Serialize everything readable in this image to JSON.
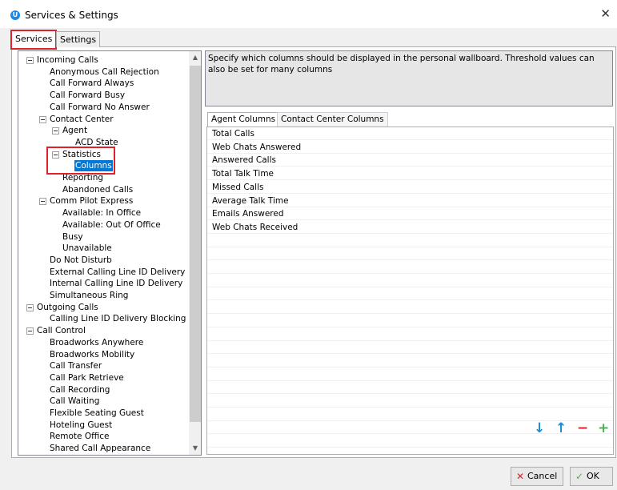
{
  "window": {
    "title": "Services & Settings",
    "app_icon_letter": "U",
    "close_glyph": "✕"
  },
  "tabs": [
    {
      "label": "Services",
      "active": true
    },
    {
      "label": "Settings",
      "active": false
    }
  ],
  "tree": {
    "items": [
      {
        "label": "Incoming Calls",
        "level": 0,
        "expandable": true
      },
      {
        "label": "Anonymous Call Rejection",
        "level": 1
      },
      {
        "label": "Call Forward Always",
        "level": 1
      },
      {
        "label": "Call Forward Busy",
        "level": 1
      },
      {
        "label": "Call Forward No Answer",
        "level": 1
      },
      {
        "label": "Contact Center",
        "level": 1,
        "expandable": true
      },
      {
        "label": "Agent",
        "level": 2,
        "expandable": true
      },
      {
        "label": "ACD State",
        "level": 3
      },
      {
        "label": "Statistics",
        "level": 2,
        "expandable": true,
        "highlighted": true
      },
      {
        "label": "Columns",
        "level": 3,
        "selected": true,
        "highlighted": true
      },
      {
        "label": "Reporting",
        "level": 2
      },
      {
        "label": "Abandoned Calls",
        "level": 2
      },
      {
        "label": "Comm Pilot Express",
        "level": 1,
        "expandable": true
      },
      {
        "label": "Available: In Office",
        "level": 2
      },
      {
        "label": "Available: Out Of Office",
        "level": 2
      },
      {
        "label": "Busy",
        "level": 2
      },
      {
        "label": "Unavailable",
        "level": 2
      },
      {
        "label": "Do Not Disturb",
        "level": 1
      },
      {
        "label": "External Calling Line ID Delivery",
        "level": 1
      },
      {
        "label": "Internal Calling Line ID Delivery",
        "level": 1
      },
      {
        "label": "Simultaneous Ring",
        "level": 1
      },
      {
        "label": "Outgoing Calls",
        "level": 0,
        "expandable": true
      },
      {
        "label": "Calling Line ID Delivery Blocking",
        "level": 1
      },
      {
        "label": "Call Control",
        "level": 0,
        "expandable": true
      },
      {
        "label": "Broadworks Anywhere",
        "level": 1
      },
      {
        "label": "Broadworks Mobility",
        "level": 1
      },
      {
        "label": "Call Transfer",
        "level": 1
      },
      {
        "label": "Call Park Retrieve",
        "level": 1
      },
      {
        "label": "Call Recording",
        "level": 1
      },
      {
        "label": "Call Waiting",
        "level": 1
      },
      {
        "label": "Flexible Seating Guest",
        "level": 1
      },
      {
        "label": "Hoteling Guest",
        "level": 1
      },
      {
        "label": "Remote Office",
        "level": 1
      },
      {
        "label": "Shared Call Appearance",
        "level": 1
      }
    ]
  },
  "description": "Specify which columns should be displayed in the personal wallboard.  Threshold values can also be set for many columns",
  "column_tabs": [
    {
      "label": "Agent Columns",
      "active": true
    },
    {
      "label": "Contact Center Columns",
      "active": false
    }
  ],
  "columns": [
    "Total Calls",
    "Web Chats Answered",
    "Answered Calls",
    "Total Talk Time",
    "Missed Calls",
    "Average Talk Time",
    "Emails Answered",
    "Web Chats Received"
  ],
  "actions": {
    "move_down": "↓",
    "move_up": "↑",
    "remove": "−",
    "add": "+",
    "colors": {
      "arrows": "#1a8ed6",
      "remove": "#e0202a",
      "add": "#4caf50"
    }
  },
  "buttons": {
    "cancel": "Cancel",
    "ok": "OK",
    "cancel_icon": "✕",
    "ok_icon": "✓"
  },
  "colors": {
    "selection": "#0078d7",
    "highlight": "#e0202a"
  }
}
